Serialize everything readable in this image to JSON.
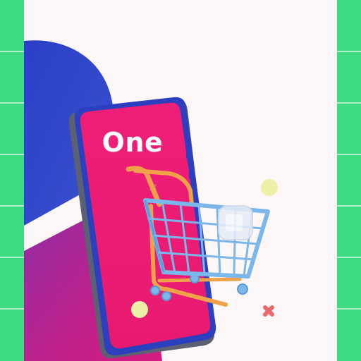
{
  "brand": {
    "label": "One"
  },
  "colors": {
    "background": "#fdf8f7",
    "side_strip": "#3ddc84",
    "phone_screen": "#ee1f76",
    "phone_frame": "#2b3fbf",
    "backdrop_blue": "#2c46c4",
    "backdrop_magenta": "#b8208a",
    "cart_basket": "#7bb7ea",
    "cart_handle": "#f2a14b"
  },
  "icons": [
    "smartphone-illustration",
    "shopping-cart-icon",
    "sparkle-icon",
    "bubble-icon"
  ]
}
